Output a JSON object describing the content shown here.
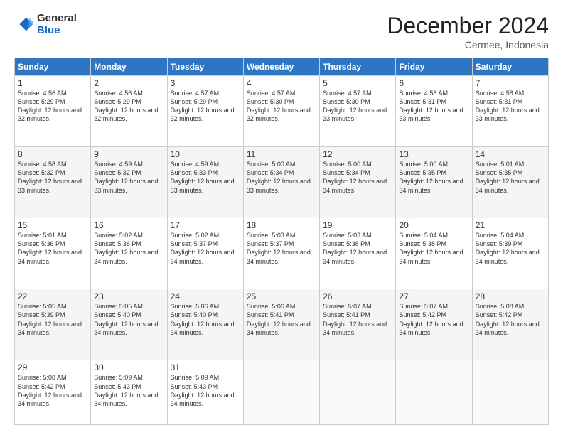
{
  "logo": {
    "general": "General",
    "blue": "Blue"
  },
  "title": "December 2024",
  "subtitle": "Cermee, Indonesia",
  "days_header": [
    "Sunday",
    "Monday",
    "Tuesday",
    "Wednesday",
    "Thursday",
    "Friday",
    "Saturday"
  ],
  "weeks": [
    [
      {
        "day": "1",
        "sunrise": "4:56 AM",
        "sunset": "5:29 PM",
        "daylight": "12 hours and 32 minutes."
      },
      {
        "day": "2",
        "sunrise": "4:56 AM",
        "sunset": "5:29 PM",
        "daylight": "12 hours and 32 minutes."
      },
      {
        "day": "3",
        "sunrise": "4:57 AM",
        "sunset": "5:29 PM",
        "daylight": "12 hours and 32 minutes."
      },
      {
        "day": "4",
        "sunrise": "4:57 AM",
        "sunset": "5:30 PM",
        "daylight": "12 hours and 32 minutes."
      },
      {
        "day": "5",
        "sunrise": "4:57 AM",
        "sunset": "5:30 PM",
        "daylight": "12 hours and 33 minutes."
      },
      {
        "day": "6",
        "sunrise": "4:58 AM",
        "sunset": "5:31 PM",
        "daylight": "12 hours and 33 minutes."
      },
      {
        "day": "7",
        "sunrise": "4:58 AM",
        "sunset": "5:31 PM",
        "daylight": "12 hours and 33 minutes."
      }
    ],
    [
      {
        "day": "8",
        "sunrise": "4:58 AM",
        "sunset": "5:32 PM",
        "daylight": "12 hours and 33 minutes."
      },
      {
        "day": "9",
        "sunrise": "4:59 AM",
        "sunset": "5:32 PM",
        "daylight": "12 hours and 33 minutes."
      },
      {
        "day": "10",
        "sunrise": "4:59 AM",
        "sunset": "5:33 PM",
        "daylight": "12 hours and 33 minutes."
      },
      {
        "day": "11",
        "sunrise": "5:00 AM",
        "sunset": "5:34 PM",
        "daylight": "12 hours and 33 minutes."
      },
      {
        "day": "12",
        "sunrise": "5:00 AM",
        "sunset": "5:34 PM",
        "daylight": "12 hours and 34 minutes."
      },
      {
        "day": "13",
        "sunrise": "5:00 AM",
        "sunset": "5:35 PM",
        "daylight": "12 hours and 34 minutes."
      },
      {
        "day": "14",
        "sunrise": "5:01 AM",
        "sunset": "5:35 PM",
        "daylight": "12 hours and 34 minutes."
      }
    ],
    [
      {
        "day": "15",
        "sunrise": "5:01 AM",
        "sunset": "5:36 PM",
        "daylight": "12 hours and 34 minutes."
      },
      {
        "day": "16",
        "sunrise": "5:02 AM",
        "sunset": "5:36 PM",
        "daylight": "12 hours and 34 minutes."
      },
      {
        "day": "17",
        "sunrise": "5:02 AM",
        "sunset": "5:37 PM",
        "daylight": "12 hours and 34 minutes."
      },
      {
        "day": "18",
        "sunrise": "5:03 AM",
        "sunset": "5:37 PM",
        "daylight": "12 hours and 34 minutes."
      },
      {
        "day": "19",
        "sunrise": "5:03 AM",
        "sunset": "5:38 PM",
        "daylight": "12 hours and 34 minutes."
      },
      {
        "day": "20",
        "sunrise": "5:04 AM",
        "sunset": "5:38 PM",
        "daylight": "12 hours and 34 minutes."
      },
      {
        "day": "21",
        "sunrise": "5:04 AM",
        "sunset": "5:39 PM",
        "daylight": "12 hours and 34 minutes."
      }
    ],
    [
      {
        "day": "22",
        "sunrise": "5:05 AM",
        "sunset": "5:39 PM",
        "daylight": "12 hours and 34 minutes."
      },
      {
        "day": "23",
        "sunrise": "5:05 AM",
        "sunset": "5:40 PM",
        "daylight": "12 hours and 34 minutes."
      },
      {
        "day": "24",
        "sunrise": "5:06 AM",
        "sunset": "5:40 PM",
        "daylight": "12 hours and 34 minutes."
      },
      {
        "day": "25",
        "sunrise": "5:06 AM",
        "sunset": "5:41 PM",
        "daylight": "12 hours and 34 minutes."
      },
      {
        "day": "26",
        "sunrise": "5:07 AM",
        "sunset": "5:41 PM",
        "daylight": "12 hours and 34 minutes."
      },
      {
        "day": "27",
        "sunrise": "5:07 AM",
        "sunset": "5:42 PM",
        "daylight": "12 hours and 34 minutes."
      },
      {
        "day": "28",
        "sunrise": "5:08 AM",
        "sunset": "5:42 PM",
        "daylight": "12 hours and 34 minutes."
      }
    ],
    [
      {
        "day": "29",
        "sunrise": "5:08 AM",
        "sunset": "5:42 PM",
        "daylight": "12 hours and 34 minutes."
      },
      {
        "day": "30",
        "sunrise": "5:09 AM",
        "sunset": "5:43 PM",
        "daylight": "12 hours and 34 minutes."
      },
      {
        "day": "31",
        "sunrise": "5:09 AM",
        "sunset": "5:43 PM",
        "daylight": "12 hours and 34 minutes."
      },
      null,
      null,
      null,
      null
    ]
  ]
}
